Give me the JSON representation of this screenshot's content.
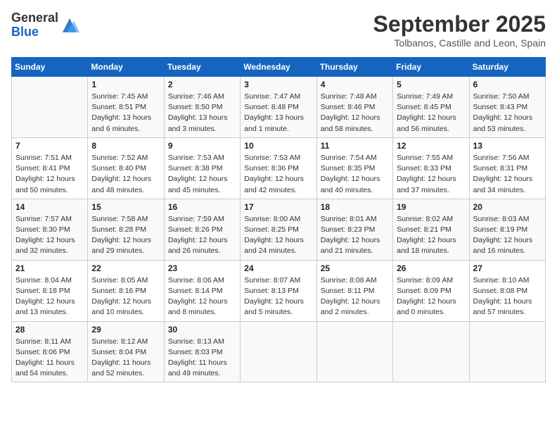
{
  "header": {
    "logo_general": "General",
    "logo_blue": "Blue",
    "month": "September 2025",
    "location": "Tolbanos, Castille and Leon, Spain"
  },
  "weekdays": [
    "Sunday",
    "Monday",
    "Tuesday",
    "Wednesday",
    "Thursday",
    "Friday",
    "Saturday"
  ],
  "weeks": [
    [
      {
        "day": "",
        "info": ""
      },
      {
        "day": "1",
        "info": "Sunrise: 7:45 AM\nSunset: 8:51 PM\nDaylight: 13 hours\nand 6 minutes."
      },
      {
        "day": "2",
        "info": "Sunrise: 7:46 AM\nSunset: 8:50 PM\nDaylight: 13 hours\nand 3 minutes."
      },
      {
        "day": "3",
        "info": "Sunrise: 7:47 AM\nSunset: 8:48 PM\nDaylight: 13 hours\nand 1 minute."
      },
      {
        "day": "4",
        "info": "Sunrise: 7:48 AM\nSunset: 8:46 PM\nDaylight: 12 hours\nand 58 minutes."
      },
      {
        "day": "5",
        "info": "Sunrise: 7:49 AM\nSunset: 8:45 PM\nDaylight: 12 hours\nand 56 minutes."
      },
      {
        "day": "6",
        "info": "Sunrise: 7:50 AM\nSunset: 8:43 PM\nDaylight: 12 hours\nand 53 minutes."
      }
    ],
    [
      {
        "day": "7",
        "info": "Sunrise: 7:51 AM\nSunset: 8:41 PM\nDaylight: 12 hours\nand 50 minutes."
      },
      {
        "day": "8",
        "info": "Sunrise: 7:52 AM\nSunset: 8:40 PM\nDaylight: 12 hours\nand 48 minutes."
      },
      {
        "day": "9",
        "info": "Sunrise: 7:53 AM\nSunset: 8:38 PM\nDaylight: 12 hours\nand 45 minutes."
      },
      {
        "day": "10",
        "info": "Sunrise: 7:53 AM\nSunset: 8:36 PM\nDaylight: 12 hours\nand 42 minutes."
      },
      {
        "day": "11",
        "info": "Sunrise: 7:54 AM\nSunset: 8:35 PM\nDaylight: 12 hours\nand 40 minutes."
      },
      {
        "day": "12",
        "info": "Sunrise: 7:55 AM\nSunset: 8:33 PM\nDaylight: 12 hours\nand 37 minutes."
      },
      {
        "day": "13",
        "info": "Sunrise: 7:56 AM\nSunset: 8:31 PM\nDaylight: 12 hours\nand 34 minutes."
      }
    ],
    [
      {
        "day": "14",
        "info": "Sunrise: 7:57 AM\nSunset: 8:30 PM\nDaylight: 12 hours\nand 32 minutes."
      },
      {
        "day": "15",
        "info": "Sunrise: 7:58 AM\nSunset: 8:28 PM\nDaylight: 12 hours\nand 29 minutes."
      },
      {
        "day": "16",
        "info": "Sunrise: 7:59 AM\nSunset: 8:26 PM\nDaylight: 12 hours\nand 26 minutes."
      },
      {
        "day": "17",
        "info": "Sunrise: 8:00 AM\nSunset: 8:25 PM\nDaylight: 12 hours\nand 24 minutes."
      },
      {
        "day": "18",
        "info": "Sunrise: 8:01 AM\nSunset: 8:23 PM\nDaylight: 12 hours\nand 21 minutes."
      },
      {
        "day": "19",
        "info": "Sunrise: 8:02 AM\nSunset: 8:21 PM\nDaylight: 12 hours\nand 18 minutes."
      },
      {
        "day": "20",
        "info": "Sunrise: 8:03 AM\nSunset: 8:19 PM\nDaylight: 12 hours\nand 16 minutes."
      }
    ],
    [
      {
        "day": "21",
        "info": "Sunrise: 8:04 AM\nSunset: 8:18 PM\nDaylight: 12 hours\nand 13 minutes."
      },
      {
        "day": "22",
        "info": "Sunrise: 8:05 AM\nSunset: 8:16 PM\nDaylight: 12 hours\nand 10 minutes."
      },
      {
        "day": "23",
        "info": "Sunrise: 8:06 AM\nSunset: 8:14 PM\nDaylight: 12 hours\nand 8 minutes."
      },
      {
        "day": "24",
        "info": "Sunrise: 8:07 AM\nSunset: 8:13 PM\nDaylight: 12 hours\nand 5 minutes."
      },
      {
        "day": "25",
        "info": "Sunrise: 8:08 AM\nSunset: 8:11 PM\nDaylight: 12 hours\nand 2 minutes."
      },
      {
        "day": "26",
        "info": "Sunrise: 8:09 AM\nSunset: 8:09 PM\nDaylight: 12 hours\nand 0 minutes."
      },
      {
        "day": "27",
        "info": "Sunrise: 8:10 AM\nSunset: 8:08 PM\nDaylight: 11 hours\nand 57 minutes."
      }
    ],
    [
      {
        "day": "28",
        "info": "Sunrise: 8:11 AM\nSunset: 8:06 PM\nDaylight: 11 hours\nand 54 minutes."
      },
      {
        "day": "29",
        "info": "Sunrise: 8:12 AM\nSunset: 8:04 PM\nDaylight: 11 hours\nand 52 minutes."
      },
      {
        "day": "30",
        "info": "Sunrise: 8:13 AM\nSunset: 8:03 PM\nDaylight: 11 hours\nand 49 minutes."
      },
      {
        "day": "",
        "info": ""
      },
      {
        "day": "",
        "info": ""
      },
      {
        "day": "",
        "info": ""
      },
      {
        "day": "",
        "info": ""
      }
    ]
  ]
}
